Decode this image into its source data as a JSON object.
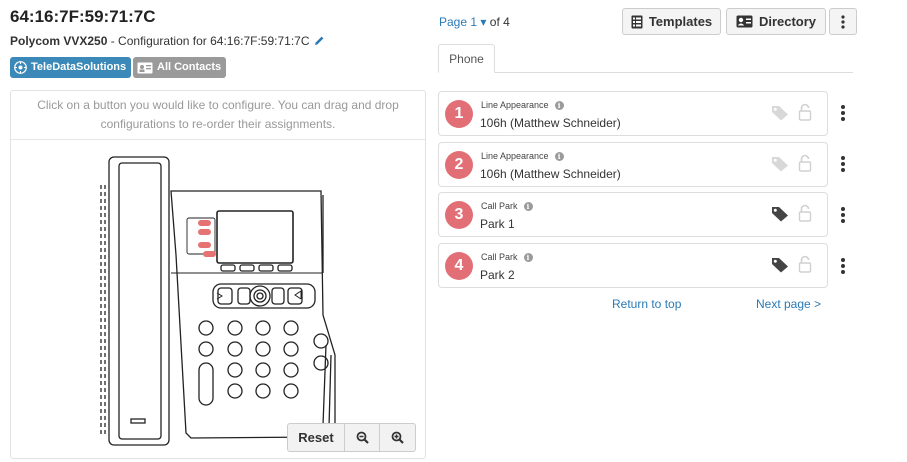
{
  "header": {
    "mac": "64:16:7F:59:71:7C",
    "model": "Polycom VVX250",
    "config_label": " - Configuration for 64:16:7F:59:71:7C"
  },
  "badges": [
    {
      "label": "TeleDataSolutions",
      "icon": "teledata-logo-icon",
      "color": "#3a89b8"
    },
    {
      "label": "All Contacts",
      "icon": "contact-card-icon",
      "color": "#9a9a9a"
    }
  ],
  "instructions": {
    "line1": "Click on a button you would like to configure. You can drag and drop",
    "line2": "configurations to re-order their assignments."
  },
  "zoom": {
    "reset_label": "Reset",
    "zoom_out_icon": "zoom-out-icon",
    "zoom_in_icon": "zoom-in-icon"
  },
  "pager": {
    "prefix": "Page",
    "current": "1",
    "caret": "▾",
    "suffix": "of 4"
  },
  "toolbar": {
    "templates_label": "Templates",
    "directory_label": "Directory"
  },
  "tabs": [
    {
      "label": "Phone"
    }
  ],
  "lines": [
    {
      "number": "1",
      "type": "Line Appearance",
      "value": "106h (Matthew Schneider)",
      "tag_active": false
    },
    {
      "number": "2",
      "type": "Line Appearance",
      "value": "106h (Matthew Schneider)",
      "tag_active": false
    },
    {
      "number": "3",
      "type": "Call Park",
      "value": "Park 1",
      "tag_active": true
    },
    {
      "number": "4",
      "type": "Call Park",
      "value": "Park 2",
      "tag_active": true
    }
  ],
  "links": {
    "return_to_top": "Return to top",
    "next_page": "Next page >"
  },
  "colors": {
    "accent": "#2a7ab5",
    "line_number": "#e36f76",
    "badge_blue": "#3a89b8",
    "badge_gray": "#9a9a9a"
  }
}
